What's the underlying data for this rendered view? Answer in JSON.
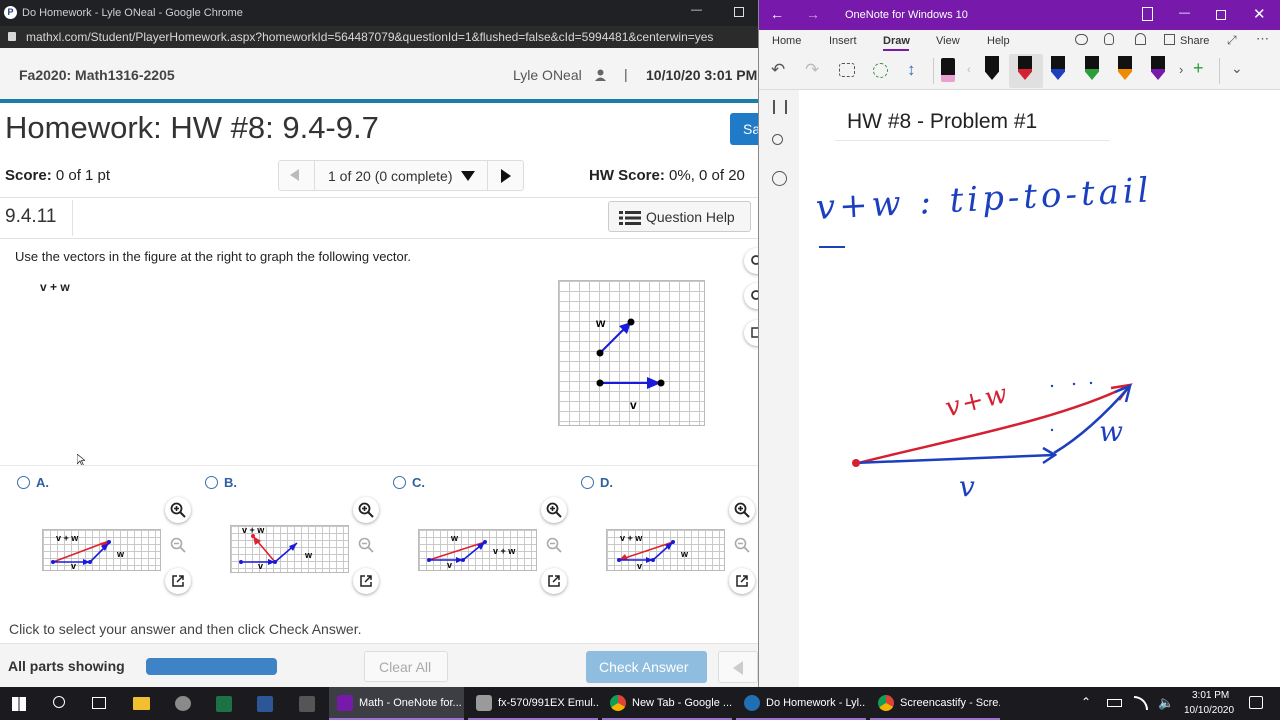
{
  "chrome": {
    "tab_title": "Do Homework - Lyle ONeal - Google Chrome",
    "url": "mathxl.com/Student/PlayerHomework.aspx?homeworkId=564487079&questionId=1&flushed=false&cId=5994481&centerwin=yes"
  },
  "mathxl": {
    "course": "Fa2020: Math1316-2205",
    "user": "Lyle ONeal",
    "datetime": "10/10/20 3:01 PM",
    "hw_title": "Homework: HW #8: 9.4-9.7",
    "save_button": "Sa",
    "score_label": "Score:",
    "score_value": "0 of 1 pt",
    "progress": "1 of 20 (0 complete)",
    "hw_score_label": "HW Score:",
    "hw_score_value": "0%, 0 of 20",
    "question_number": "9.4.11",
    "question_help": "Question Help",
    "instructions": "Use the vectors in the figure at the right to graph the following vector.",
    "expression": "v + w",
    "figure_labels": {
      "w": "w",
      "v": "v"
    },
    "options": [
      {
        "letter": "A.",
        "vw": "v + w",
        "w": "w",
        "v": "v"
      },
      {
        "letter": "B.",
        "vw": "v + w",
        "w": "w",
        "v": "v"
      },
      {
        "letter": "C.",
        "vw": "v + w",
        "w": "w",
        "v": "v"
      },
      {
        "letter": "D.",
        "vw": "v + w",
        "w": "w",
        "v": "v"
      }
    ],
    "click_instruction": "Click to select your answer and then click Check Answer.",
    "all_parts": "All parts showing",
    "clear_all": "Clear All",
    "check_answer": "Check Answer",
    "colors": {
      "accent": "#1a7fa8",
      "vector_blue": "#1a1adc",
      "vector_red": "#e0202a",
      "check_btn": "#8fbde0"
    }
  },
  "onenote": {
    "title": "OneNote for Windows 10",
    "tabs": [
      "Home",
      "Insert",
      "Draw",
      "View",
      "Help"
    ],
    "active_tab": "Draw",
    "share": "Share",
    "page_title": "HW #8 - Problem #1",
    "ink_heading": "v+w : tip-to-tail",
    "ink_vw": "v+w",
    "ink_w": "w",
    "ink_v": "v",
    "colors": {
      "brand": "#7719aa",
      "ink_blue": "#1b3fbf",
      "ink_red": "#d42030"
    }
  },
  "taskbar": {
    "apps": [
      {
        "label": "Math - OneNote for...",
        "icon": "onenote-icon"
      },
      {
        "label": "fx-570/991EX Emul...",
        "icon": "calculator-icon"
      },
      {
        "label": "New Tab - Google ...",
        "icon": "chrome-icon"
      },
      {
        "label": "Do Homework - Lyl...",
        "icon": "pearson-icon"
      },
      {
        "label": "Screencastify - Scre...",
        "icon": "chrome-icon"
      }
    ],
    "time": "3:01 PM",
    "date": "10/10/2020"
  }
}
